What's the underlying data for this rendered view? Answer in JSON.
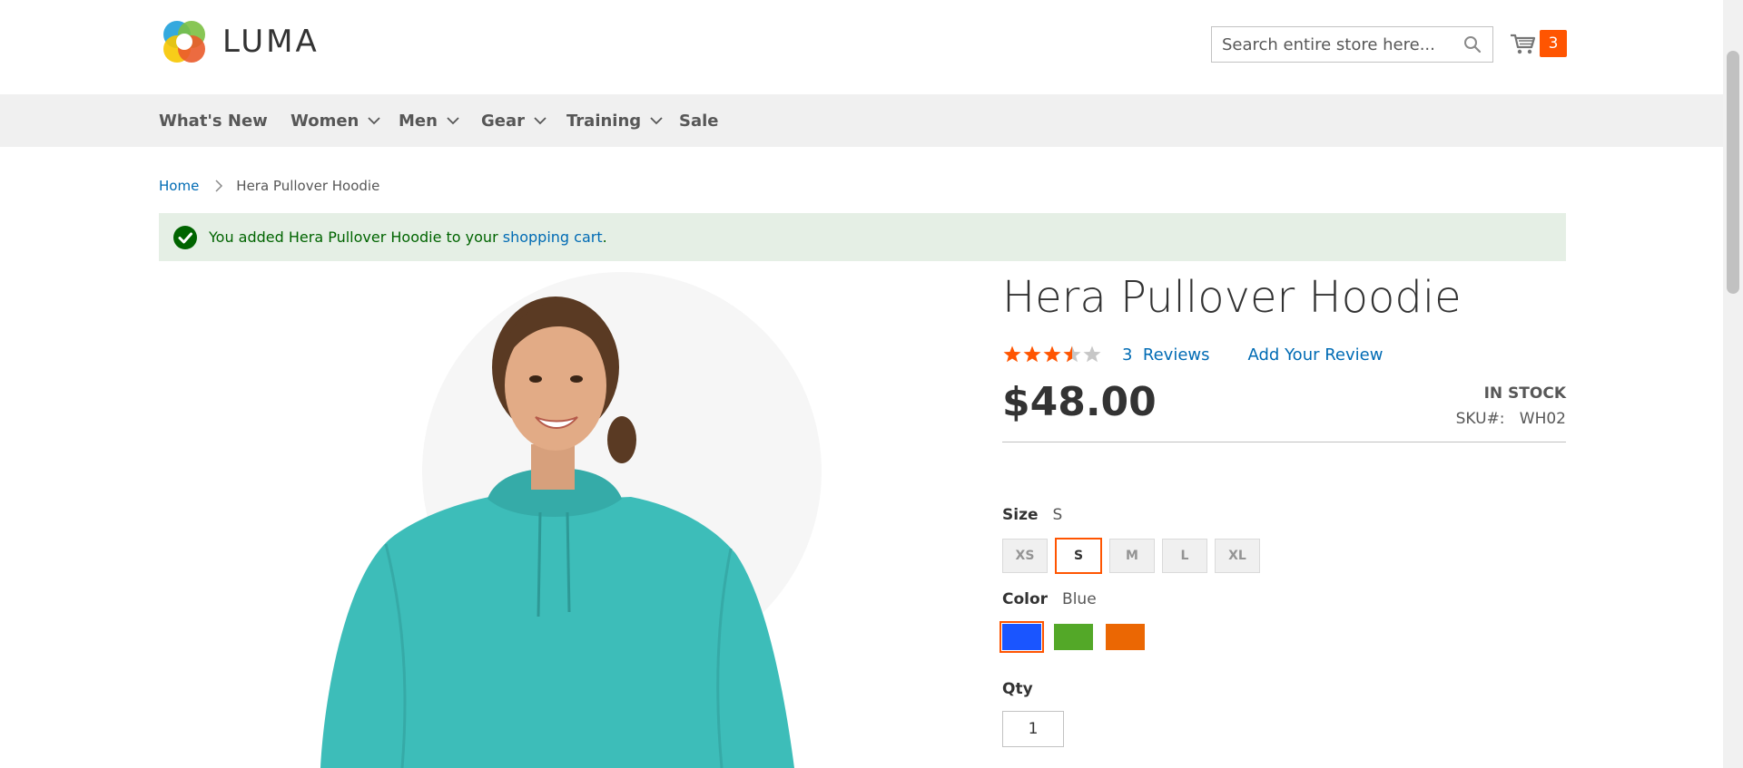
{
  "header": {
    "logo_text": "LUMA",
    "search_placeholder": "Search entire store here...",
    "cart_count": "3",
    "accent_color": "#ff5501"
  },
  "nav": {
    "items": [
      {
        "label": "What's New",
        "has_dropdown": false
      },
      {
        "label": "Women",
        "has_dropdown": true
      },
      {
        "label": "Men",
        "has_dropdown": true
      },
      {
        "label": "Gear",
        "has_dropdown": true
      },
      {
        "label": "Training",
        "has_dropdown": true
      },
      {
        "label": "Sale",
        "has_dropdown": false
      }
    ]
  },
  "breadcrumb": {
    "home": "Home",
    "current": "Hera Pullover Hoodie"
  },
  "message": {
    "prefix": "You added Hera Pullover Hoodie to your ",
    "link": "shopping cart",
    "suffix": "."
  },
  "product": {
    "title": "Hera Pullover Hoodie",
    "rating": 3.5,
    "rating_max": 5,
    "reviews_link": "3  Reviews",
    "add_review": "Add Your Review",
    "price": "$48.00",
    "stock": "IN STOCK",
    "sku_label": "SKU#:",
    "sku_value": "WH02",
    "size": {
      "label": "Size",
      "selected": "S",
      "options": [
        "XS",
        "S",
        "M",
        "L",
        "XL"
      ]
    },
    "color": {
      "label": "Color",
      "selected": "Blue",
      "options": [
        {
          "name": "Blue",
          "hex": "#1a55ff"
        },
        {
          "name": "Green",
          "hex": "#53a828"
        },
        {
          "name": "Orange",
          "hex": "#eb6703"
        }
      ]
    },
    "qty": {
      "label": "Qty",
      "value": "1"
    }
  }
}
